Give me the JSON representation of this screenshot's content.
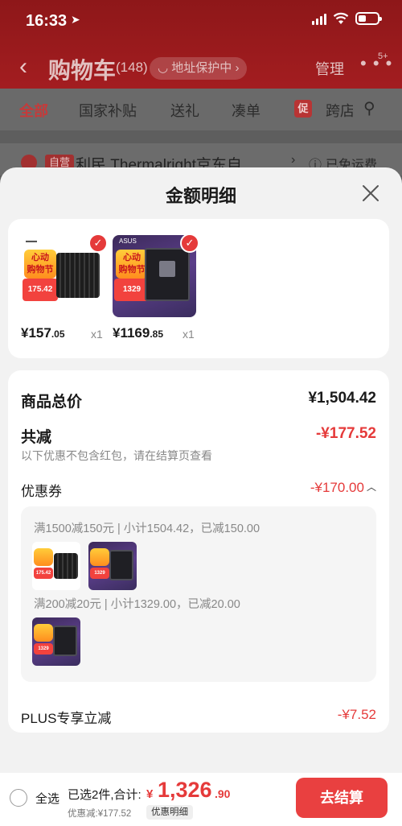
{
  "status_bar": {
    "time": "16:33",
    "battery_level": 0.4
  },
  "header": {
    "title": "购物车",
    "count": "(148)",
    "address_protection": "地址保护中",
    "manage": "管理",
    "more_badge": "5+"
  },
  "tabs": [
    {
      "label": "全部",
      "active": true
    },
    {
      "label": "国家补贴",
      "active": false
    },
    {
      "label": "送礼",
      "active": false
    },
    {
      "label": "凑单",
      "active": false
    },
    {
      "label": "跨店",
      "active": false
    }
  ],
  "promo_tab_icon": "促",
  "store": {
    "tag": "自营",
    "name": "利民 Thermalright京东自...",
    "shipping": "已免运费"
  },
  "sheet": {
    "title": "金额明细",
    "products": [
      {
        "price_int": "¥157",
        "price_dec": ".05",
        "qty": "x1",
        "badge_line1": "心动",
        "badge_line2": "购物节",
        "image_price": "175.42",
        "image": "cpu-cooler"
      },
      {
        "price_int": "¥1169",
        "price_dec": ".85",
        "qty": "x1",
        "badge_line1": "心动",
        "badge_line2": "购物节",
        "image_price": "1329",
        "image_brand": "ASUS",
        "image": "motherboard"
      }
    ],
    "total_label": "商品总价",
    "total_value": "¥1,504.42",
    "reduce_label": "共减",
    "reduce_value": "-¥177.52",
    "reduce_note": "以下优惠不包含红包，请在结算页查看",
    "coupon_label": "优惠券",
    "coupon_value": "-¥170.00",
    "coupon_groups": [
      {
        "text": "满1500减150元 | 小计1504.42，已减150.00"
      },
      {
        "text": "满200减20元 | 小计1329.00，已减20.00"
      }
    ],
    "plus_label": "PLUS专享立减",
    "plus_value": "-¥7.52"
  },
  "bottom_bar": {
    "select_all": "全选",
    "selected_info": "已选2件,合计:",
    "total_yen": "¥",
    "total_int": "1,326",
    "total_dec": ".90",
    "discount": "优惠减:¥177.52",
    "detail_label": "优惠明细",
    "checkout": "去结算"
  },
  "colors": {
    "accent": "#e94040",
    "price_red": "#e53a3a",
    "header_red": "#a31d20"
  }
}
